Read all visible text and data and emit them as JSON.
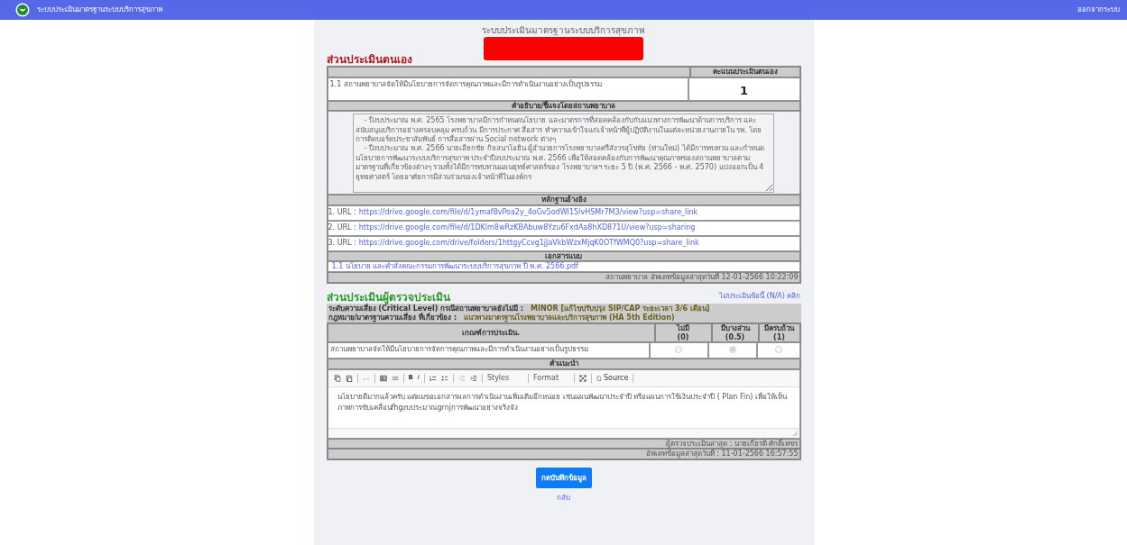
{
  "top_bar": {
    "title": "ระบบประเมินมาตรฐานระบบบริการสุขภาพ",
    "logout": "ออกจากระบบ"
  },
  "subtitle": "ระบบประเมินมาตรฐานระบบบริการสุขภาพ",
  "self_assessment": {
    "title": "ส่วนประเมินตนเอง",
    "score_header": "คะแนนประเมินตนเอง",
    "criterion": "1.1 สถานพยาบาลจัดให้มีนโยบายการจัดการคุณภาพและมีการดำเนินงานอย่างเป็นรูปธรรม",
    "score": "1",
    "description_header": "คำอธิบาย/ชี้แจงโดยสถานพยาบาล",
    "description": "    - ปีงบประมาณ พ.ศ. 2565 โรงพยาบาลมีการกำหนดนโยบาย และมาตรการที่สอดคล้องกับกับแนวทางการพัฒนาด้านการบริการ และสนับสนุนบริการอย่างครอบคลุม ครบถ้วน มีการประกาศ สื่อสาร ทำความเข้าใจแก่เจ้าหน้าที่ผู้ปฏิบัติงานในแต่ละหน่วยงานภายใน รพ. โดยการติดบอร์ดประชาสัมพันธ์ การสื่อสารผ่าน Social network ต่างๆ\n    - ปีงบประมาณ พ.ศ. 2566 นายเอียกชัย กิจสนาโอยิน ผู้อำนวยการโรงพยาบาลศรีสังวรสุโขทัย (ท่านใหม่) ได้มีการทบทวน และกำหนดนโยบายการพัฒนาระบบบริการสุขภาพ ประจำปีงบประมาณ พ.ศ. 2566 เพื่อให้สอดคล้องกับการพัฒนาคุณภาพของสถานพยาบาลตามมาตรฐานที่เกี่ยวข้องต่างๆ รวมทั้งได้มีการทบทวนแผนยุทธ์ศาสตร์ของ โรงพยาบาลฯ ระยะ 5 ปี (พ.ศ. 2566 - พ.ศ. 2570) แบ่งออกเป็น 4 ยุทธศาสตร์ โดยอาศัยการมีส่วนร่วมของเจ้าหน้าที่ในองค์กร",
    "evidence_header": "หลักฐานอ้างอิง",
    "evidence": [
      {
        "label": "1. URL :",
        "url": "https://drive.google.com/file/d/1ymaf8vPoa2y_4oGv5odWI15IvHSMr7M3/view?usp=share_link"
      },
      {
        "label": "2. URL :",
        "url": "https://drive.google.com/file/d/1DKlm8wRzKBAbuw8Yzu6FxdAa8hXD871U/view?usp=sharing"
      },
      {
        "label": "3. URL :",
        "url": "https://drive.google.com/drive/folders/1httgyCcvg1jJaVkbWzxMjqK0OTfWMQ0?usp=share_link"
      }
    ],
    "attachments_header": "เอกสารแนบ",
    "attachments": [
      "1.1 นโยบาย และคำสั่งคณะกรรมการพัฒนาระบบบริการสุขภาพ ปี พ.ศ. 2566.pdf"
    ],
    "updated": "สถานพยาบาล อัพเดทข้อมูลล่าสุดวันที่ 12-01-2566 10:22:09"
  },
  "reviewer": {
    "title": "ส่วนประเมินผู้ตรวจประเมิน",
    "na_link": "ไม่ประเมินข้อนี้ (N/A) คลิก",
    "risk_label": "ระดับความเสี่ยง (Critical Level) กรณีสถานพยาบาลยังไม่มี :",
    "risk_value": "MINOR  [แก้ไขปรับปรุง SIP/CAP ระยะเวลา 3/6 เดือน]",
    "law_label": "กฎหมาย/มาตรฐานความเสี่ยง ที่เกี่ยวข้อง :",
    "law_value": "แนวทางมาตรฐานโรงพยาบาลและบริการสุขภาพ (HA 5th Edition)",
    "criteria_header": "เกณฑ์การประเมิน.",
    "columns": [
      {
        "label": "ไม่มี",
        "score": "(0)"
      },
      {
        "label": "มีบางส่วน",
        "score": "(0.5)"
      },
      {
        "label": "มีครบถ้วน",
        "score": "(1)"
      }
    ],
    "criterion": "สถานพยาบาลจัดให้มีนโยบายการจัดการคุณภาพและมีการดำเนินงานอย่างเป็นรูปธรรม",
    "options": [
      {
        "selected": false
      },
      {
        "selected": true
      },
      {
        "selected": false
      }
    ],
    "advice_header": "คำแนะนำ",
    "toolbar": {
      "bold": "B",
      "italic": "I",
      "styles": "Styles",
      "format": "Format",
      "source": "Source"
    },
    "advice": "นโยบายดีมากแล้วครับ แต่ผมขอเอกสารผลการดำเนินงานเพิ่มเติมอีกหน่อย เช่นแผนพัฒนาประจำปี หรือแผนการใช้เงินประจำปี ( Plan Fin) เพื่อให้เห็นภาพการขับเคลื่อนfhgงบประมาณgrnjการพัฒนาอย่างจริงจัง",
    "last_reviewer": "ผู้ตรวจประเมินล่าสุด : นายเกียรติ ศักดิ์เพชร",
    "updated": "อัพเดทข้อมูลล่าสุดวันที่ : 11-01-2566 16:57:55"
  },
  "save_button": "กดบันทึกข้อมูล",
  "back_link": "กลับ"
}
